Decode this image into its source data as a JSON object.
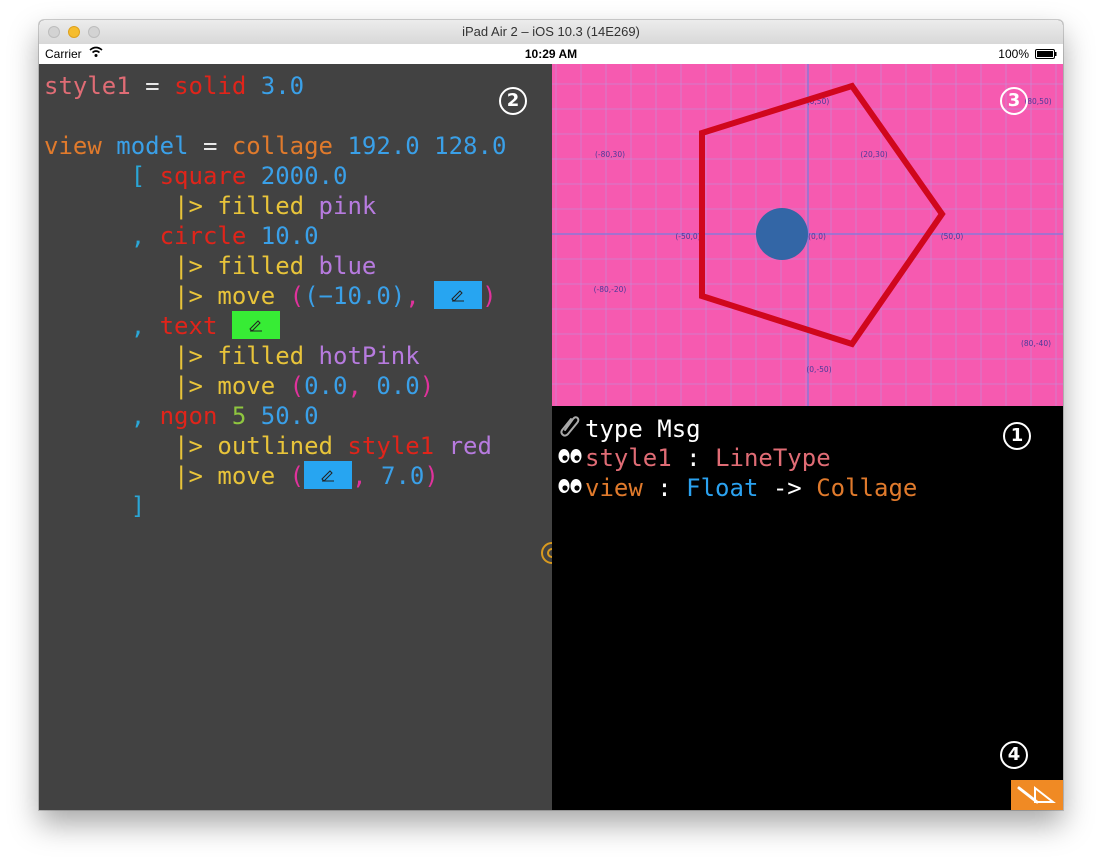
{
  "window": {
    "title": "iPad Air 2 – iOS 10.3 (14E269)"
  },
  "status_bar": {
    "carrier": "Carrier",
    "time": "10:29 AM",
    "battery": "100%"
  },
  "editor": {
    "l1": {
      "a": "style1",
      "b": " = ",
      "c": "solid",
      "d": " 3.0"
    },
    "l3": {
      "a": "view",
      "b": " model",
      "c": " = ",
      "d": "collage",
      "e": " 192.0 128.0"
    },
    "l4": {
      "a": "      [ ",
      "b": "square",
      "c": " 2000.0"
    },
    "l5": {
      "a": "         |> filled",
      "b": " pink"
    },
    "l6": {
      "a": "      , ",
      "b": "circle",
      "c": " 10.0"
    },
    "l7": {
      "a": "         |> filled",
      "b": " blue"
    },
    "l8": {
      "a": "         |> move",
      "b": " (",
      "c": "(−10.0)",
      "d": ", ",
      "e": ")"
    },
    "l9": {
      "a": "      , ",
      "b": "text",
      "c": " "
    },
    "l10": {
      "a": "         |> filled",
      "b": " hotPink"
    },
    "l11": {
      "a": "         |> move",
      "b": " (",
      "c": "0.0",
      "d": ", ",
      "e": "0.0",
      "f": ")"
    },
    "l12": {
      "a": "      , ",
      "b": "ngon",
      "c": " 5",
      "d": " 50.0"
    },
    "l13": {
      "a": "         |> outlined",
      "b": " style1",
      "c": " red"
    },
    "l14": {
      "a": "         |> move",
      "b": " (",
      "c": ", ",
      "d": "7.0",
      "e": ")"
    },
    "l15": {
      "a": "      ]"
    }
  },
  "markers": {
    "one": "1",
    "two": "2",
    "three": "3",
    "four": "4"
  },
  "canvas": {
    "labels": [
      "(0,50)",
      "(80,50)",
      "(-80,30)",
      "(20,30)",
      "(-50,0)",
      "(0,0)",
      "(50,0)",
      "(-80,-20)",
      "(80,-40)",
      "(0,-50)"
    ],
    "colors": {
      "background": "#f65ab0",
      "grid": "#c78ad6",
      "polygon": "#d0071d",
      "circle": "#3366a6"
    }
  },
  "types": {
    "l1": {
      "icon": "paperclip-icon",
      "a": "type Msg"
    },
    "l2": {
      "icon": "eyes-icon",
      "a": "style1",
      "b": " : ",
      "c": "LineType"
    },
    "l3": {
      "icon": "eyes-icon",
      "a": "view",
      "b": " : ",
      "c": "Float",
      "d": " -> ",
      "e": "Collage"
    }
  }
}
